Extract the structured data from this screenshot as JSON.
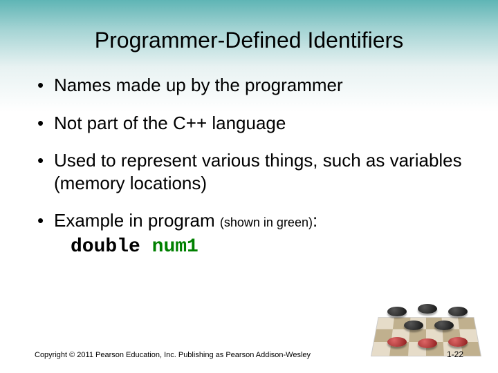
{
  "title": "Programmer-Defined Identifiers",
  "bullets": {
    "b1": "Names made up by the programmer",
    "b2": "Not part of the C++ language",
    "b3": "Used to represent various things, such as variables (memory locations)",
    "b4_lead": "Example in program ",
    "b4_paren": "(shown in green)",
    "b4_colon": ":",
    "code_kw": "double",
    "code_sp": " ",
    "code_ident": "num1"
  },
  "footer": {
    "copyright": "Copyright © 2011 Pearson Education, Inc. Publishing as Pearson Addison-Wesley",
    "pagenum": "1-22"
  }
}
